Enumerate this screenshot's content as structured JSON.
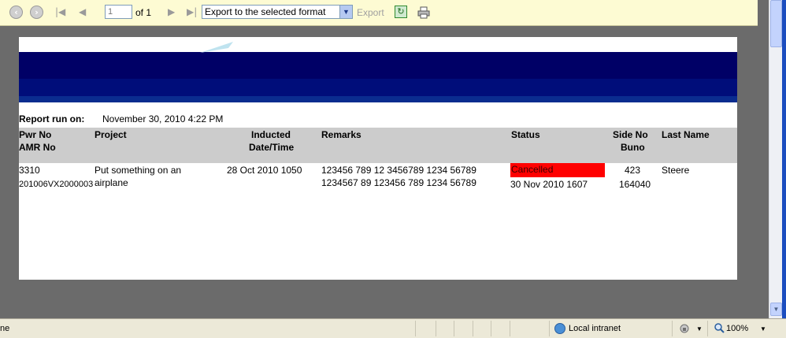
{
  "toolbar": {
    "page_current": "1",
    "page_of": "of 1",
    "export_select": "Export to the selected format",
    "export_link": "Export"
  },
  "report": {
    "run_label": "Report run on:",
    "run_value": "November 30, 2010 4:22 PM",
    "columns": {
      "pwr_no": "Pwr No",
      "amr_no": "AMR No",
      "project": "Project",
      "inducted_1": "Inducted",
      "inducted_2": "Date/Time",
      "remarks": "Remarks",
      "status": "Status",
      "side_no": "Side No",
      "buno": "Buno",
      "last_name": "Last Name"
    },
    "row": {
      "pwr_no": "3310",
      "amr_no": "201006VX2000003",
      "project_1": "Put something on an",
      "project_2": "airplane",
      "inducted": "28 Oct 2010 1050",
      "remarks_1": "123456 789 12 3456789 1234 56789",
      "remarks_2": "1234567 89 123456 789 1234 56789",
      "status": "Cancelled",
      "status_date": "30 Nov 2010 1607",
      "side_no": "423",
      "buno": "164040",
      "last_name": "Steere"
    }
  },
  "statusbar": {
    "left_text": "ne",
    "zone": "Local intranet",
    "zoom": "100%"
  },
  "colors": {
    "toolbar_bg": "#fdfbd3",
    "banner": "#000066",
    "header_bg": "#cccccc",
    "status_cancelled": "#ff0000"
  },
  "icons": [
    "back-icon",
    "forward-icon",
    "first-page-icon",
    "previous-page-icon",
    "next-page-icon",
    "last-page-icon",
    "refresh-icon",
    "print-icon",
    "globe-icon",
    "lock-icon",
    "zoom-icon"
  ]
}
